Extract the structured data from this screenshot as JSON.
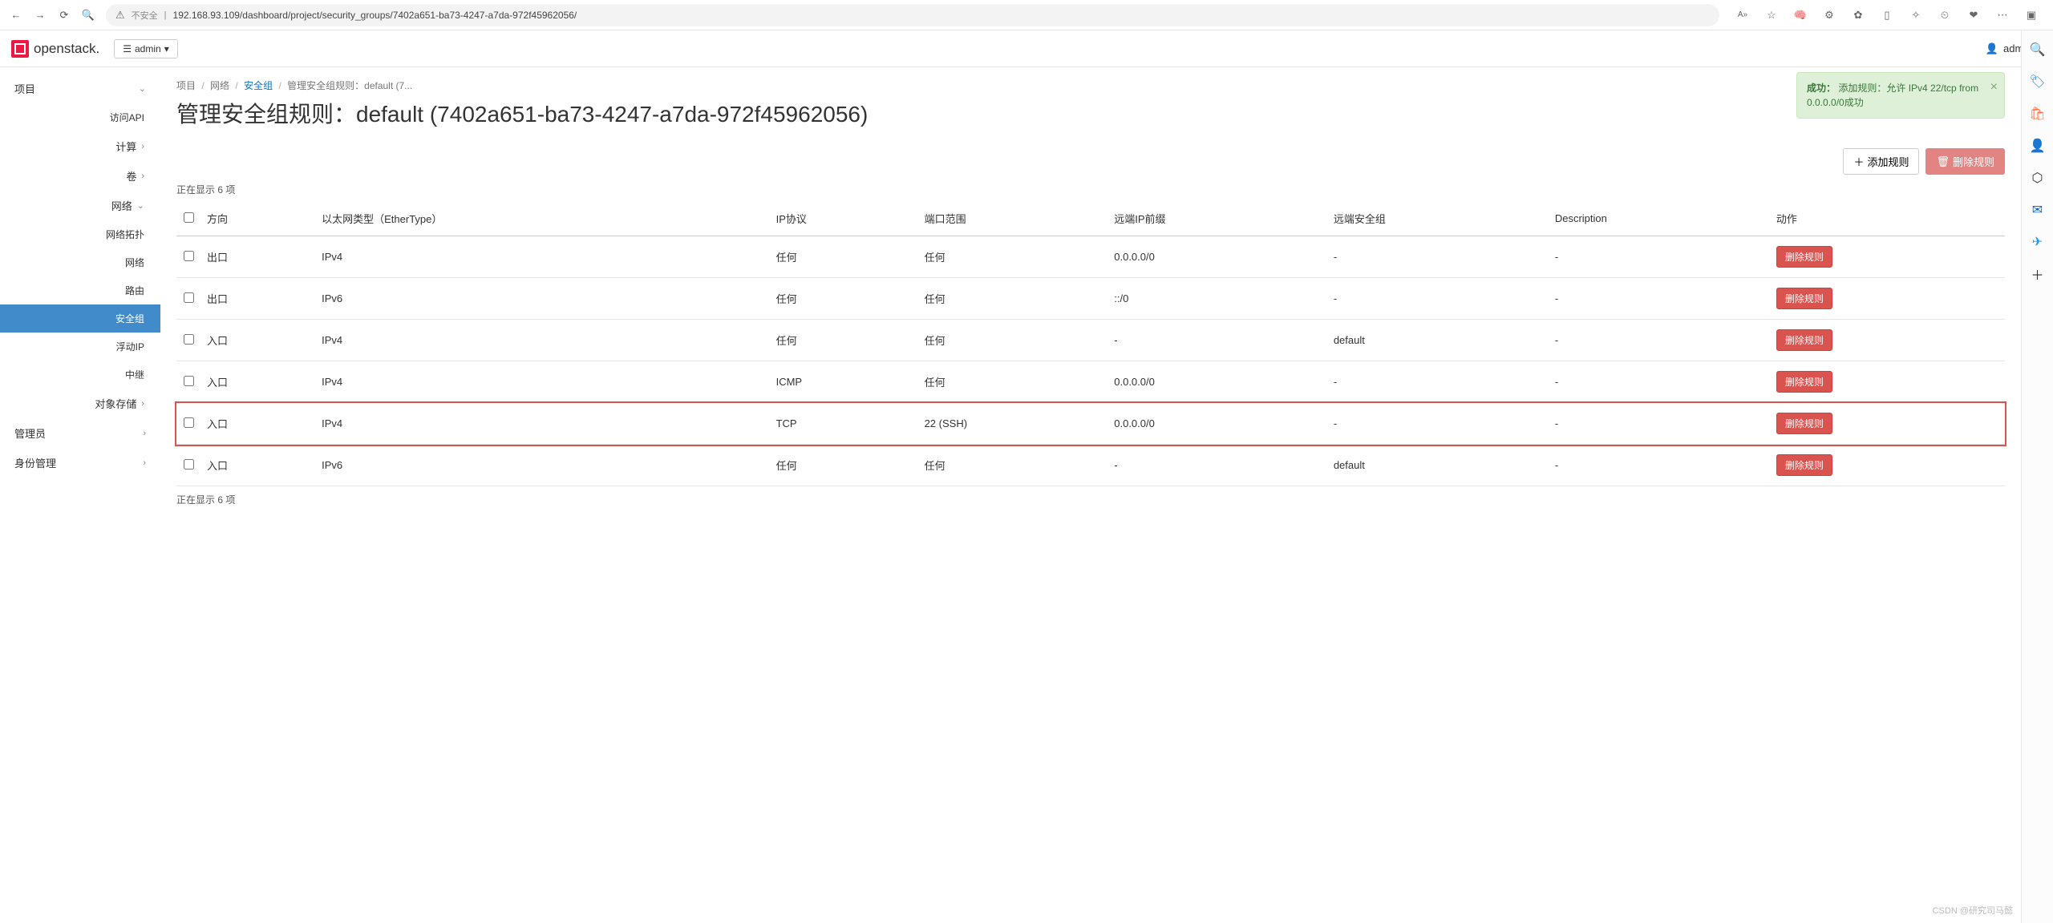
{
  "browser": {
    "insecure_label": "不安全",
    "url": "192.168.93.109/dashboard/project/security_groups/7402a651-ba73-4247-a7da-972f45962056/"
  },
  "topbar": {
    "brand": "openstack.",
    "project_selector_prefix": "admin",
    "user_label": "admin"
  },
  "sidebar": {
    "project": "项目",
    "api": "访问API",
    "compute": "计算",
    "volume": "卷",
    "network": "网络",
    "net_topology": "网络拓扑",
    "net_networks": "网络",
    "net_routers": "路由",
    "net_secgroups": "安全组",
    "net_floatingip": "浮动IP",
    "net_trunk": "中继",
    "object_storage": "对象存储",
    "admin": "管理员",
    "identity": "身份管理"
  },
  "crumb": {
    "c1": "项目",
    "c2": "网络",
    "c3": "安全组",
    "c4": "管理安全组规则：default (7..."
  },
  "page_title": "管理安全组规则：default (7402a651-ba73-4247-a7da-972f45962056)",
  "alert": {
    "strong": "成功：",
    "msg": "添加规则：允许 IPv4 22/tcp from 0.0.0.0/0成功"
  },
  "buttons": {
    "add": "添加规则",
    "delete": "删除规则"
  },
  "table": {
    "summary": "正在显示 6 项",
    "cols": {
      "direction": "方向",
      "ethertype": "以太网类型（EtherType）",
      "ip_protocol": "IP协议",
      "port_range": "端口范围",
      "remote_prefix": "远端IP前缀",
      "remote_secgroup": "远端安全组",
      "description": "Description",
      "action": "动作"
    },
    "delete_label": "删除规则",
    "rows": [
      {
        "dir": "出口",
        "eth": "IPv4",
        "proto": "任何",
        "port": "任何",
        "prefix": "0.0.0.0/0",
        "rsg": "-",
        "desc": "-",
        "hl": false
      },
      {
        "dir": "出口",
        "eth": "IPv6",
        "proto": "任何",
        "port": "任何",
        "prefix": "::/0",
        "rsg": "-",
        "desc": "-",
        "hl": false
      },
      {
        "dir": "入口",
        "eth": "IPv4",
        "proto": "任何",
        "port": "任何",
        "prefix": "-",
        "rsg": "default",
        "desc": "-",
        "hl": false
      },
      {
        "dir": "入口",
        "eth": "IPv4",
        "proto": "ICMP",
        "port": "任何",
        "prefix": "0.0.0.0/0",
        "rsg": "-",
        "desc": "-",
        "hl": false
      },
      {
        "dir": "入口",
        "eth": "IPv4",
        "proto": "TCP",
        "port": "22 (SSH)",
        "prefix": "0.0.0.0/0",
        "rsg": "-",
        "desc": "-",
        "hl": true
      },
      {
        "dir": "入口",
        "eth": "IPv6",
        "proto": "任何",
        "port": "任何",
        "prefix": "-",
        "rsg": "default",
        "desc": "-",
        "hl": false
      }
    ]
  },
  "watermark": "CSDN @研究司马懿"
}
